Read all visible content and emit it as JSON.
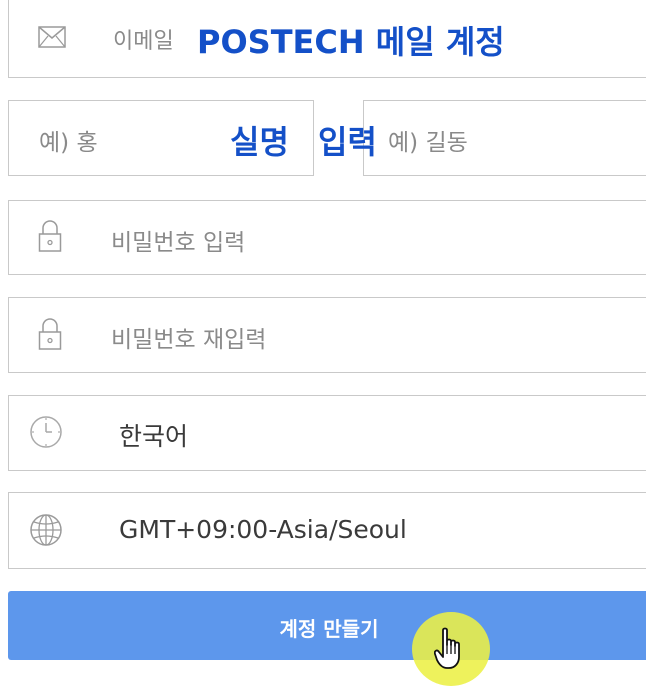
{
  "form": {
    "email": {
      "placeholder": "이메일",
      "annotation": "POSTECH 메일 계정",
      "icon": "envelope-icon"
    },
    "name": {
      "last_placeholder": "예) 홍",
      "first_placeholder": "예) 길동",
      "annotation_1": "실명",
      "annotation_2": "입력"
    },
    "password": {
      "placeholder": "비밀번호 입력",
      "icon": "lock-icon"
    },
    "password_confirm": {
      "placeholder": "비밀번호 재입력",
      "icon": "lock-icon"
    },
    "language": {
      "value": "한국어",
      "icon": "clock-icon"
    },
    "timezone": {
      "value": "GMT+09:00-Asia/Seoul",
      "icon": "globe-icon"
    },
    "submit_label": "계정 만들기"
  },
  "colors": {
    "annotation": "#1450c8",
    "button": "#5d97ec",
    "cursor_highlight": "#ecf046"
  }
}
